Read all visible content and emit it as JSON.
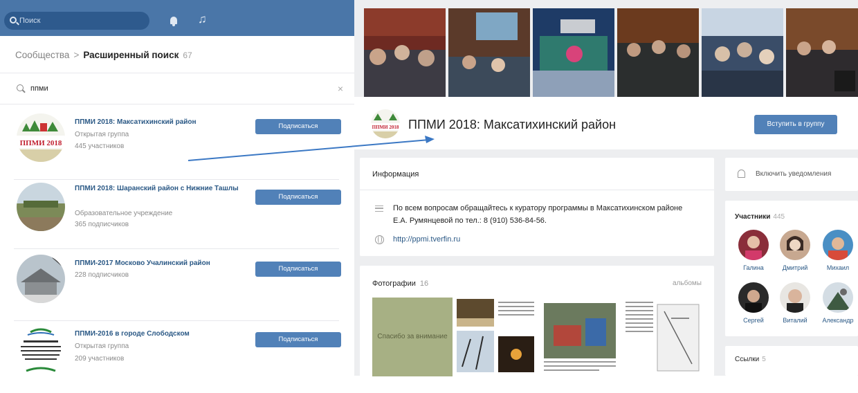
{
  "topbar": {
    "search_placeholder": "Поиск",
    "bell_icon": "bell-icon",
    "music_icon": "music-note-icon",
    "color": "#4a76a8"
  },
  "breadcrumb": {
    "root": "Сообщества",
    "separator": ">",
    "current": "Расширенный поиск",
    "count": "67"
  },
  "search": {
    "query": "ппми",
    "clear": "×"
  },
  "results": [
    {
      "name": "ППМИ 2018: Максатихинский район",
      "lines": [
        "Открытая группа",
        "445 участников"
      ],
      "button": "Подписаться"
    },
    {
      "name": "ППМИ 2018: Шаранский район с Нижние Ташлы",
      "lines": [
        "Образовательное учреждение",
        "365 подписчиков"
      ],
      "button": "Подписаться"
    },
    {
      "name": "ППМИ-2017 Москово Учалинский район",
      "lines": [
        "228 подписчиков"
      ],
      "button": "Подписаться"
    },
    {
      "name": "ППМИ-2016 в городе Слободском",
      "lines": [
        "Открытая группа",
        "209 участников"
      ],
      "button": "Подписаться"
    }
  ],
  "result_logos": {
    "r1": "ППМИ 2018",
    "r4": "2016 год Проект по поддержке местных инициатив в Кировской области город Слободской"
  },
  "group": {
    "title": "ППМИ 2018: Максатихинский район",
    "join_button": "Вступить в группу",
    "info_header": "Информация",
    "description": "По всем вопросам обращайтесь к куратору программы в Максатихинском районе Е.А. Румянцевой по тел.: 8 (910) 536-84-56.",
    "website": "http://ppmi.tverfin.ru",
    "photos_header": "Фотографии",
    "photos_count": "16",
    "albums_link": "альбомы",
    "thanks_photo": "Спасибо за внимание"
  },
  "sidebar": {
    "notifications": "Включить уведомления",
    "members_header": "Участники",
    "members_count": "445",
    "members": [
      "Галина",
      "Дмитрий",
      "Михаил",
      "Сергей",
      "Виталий",
      "Александр"
    ],
    "links_header": "Ссылки",
    "links_count": "5"
  },
  "colors": {
    "accent": "#5181b8",
    "link": "#2a5885",
    "annotation_arrow": "#3b78c4"
  }
}
